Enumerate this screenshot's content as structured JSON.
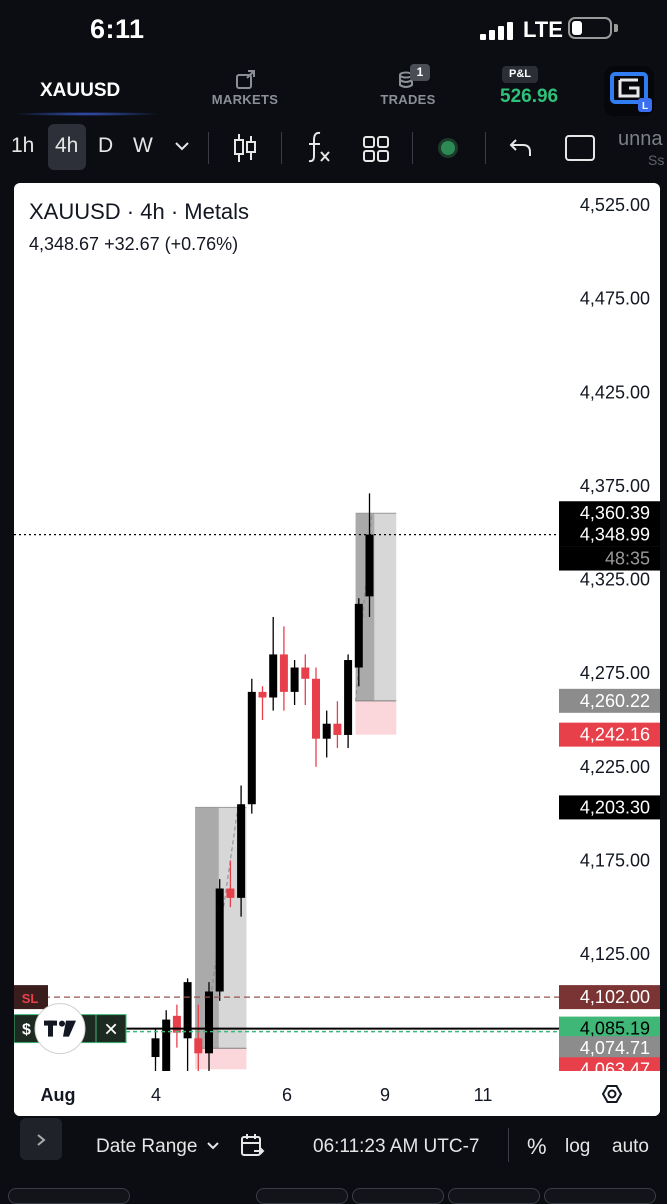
{
  "status": {
    "time": "6:11",
    "network": "LTE"
  },
  "nav": {
    "symbol_tab": "XAUUSD",
    "markets_label": "MARKETS",
    "trades_label": "TRADES",
    "trades_badge": "1",
    "pnl_label": "P&L",
    "pnl_value": "526.96",
    "pnl_color": "#2fc07a"
  },
  "toolbar": {
    "timeframes": [
      "1h",
      "4h",
      "D",
      "W"
    ],
    "active_timeframe": "4h",
    "layout_name": "unna",
    "layout_sub": "Ss"
  },
  "chart": {
    "title": "XAUUSD · 4h · Metals",
    "ohlc_line": "4,348.67  +32.67 (+0.76%)",
    "x_tick_labels": [
      "Aug",
      "4",
      "6",
      "9",
      "11"
    ],
    "trade_markers": {
      "sl_label": "SL",
      "close_symbol": "✕"
    }
  },
  "chart_data": {
    "type": "candlestick",
    "y_ticks": [
      4525,
      4475,
      4425,
      4375,
      4325,
      4275,
      4225,
      4175,
      4125
    ],
    "y_tick_labels": [
      "4,525.00",
      "4,475.00",
      "4,425.00",
      "4,375.00",
      "4,325.00",
      "4,275.00",
      "4,225.00",
      "4,175.00",
      "4,125.00"
    ],
    "x_labels": [
      "Aug",
      "4",
      "6",
      "9",
      "11"
    ],
    "price_tags": [
      {
        "label": "4,360.39",
        "price": 4360.39,
        "bg": "#000000",
        "fg": "#ffffff"
      },
      {
        "label": "4,348.99",
        "price": 4348.99,
        "bg": "#000000",
        "fg": "#ffffff"
      },
      {
        "label": "48:35",
        "price": 4336.2,
        "bg": "#000000",
        "fg": "#9a9a9a"
      },
      {
        "label": "4,260.22",
        "price": 4260.22,
        "bg": "#8c8c8c",
        "fg": "#ffffff"
      },
      {
        "label": "4,242.16",
        "price": 4242.16,
        "bg": "#e8404a",
        "fg": "#ffffff"
      },
      {
        "label": "4,203.30",
        "price": 4203.3,
        "bg": "#000000",
        "fg": "#ffffff"
      },
      {
        "label": "4,102.00",
        "price": 4102.0,
        "bg": "#7a3434",
        "fg": "#ffffff"
      },
      {
        "label": "4,085.19",
        "price": 4085.19,
        "bg": "#3fb777",
        "fg": "#000000"
      },
      {
        "label": "4,074.71",
        "price": 4074.71,
        "bg": "#8c8c8c",
        "fg": "#ffffff"
      },
      {
        "label": "4,063.47",
        "price": 4063.47,
        "bg": "#e8404a",
        "fg": "#ffffff"
      }
    ],
    "current_price": 4348.99,
    "stop_loss": 4102.0,
    "entry_price": 4085.19,
    "candles": [
      {
        "t": 0,
        "o": 4070,
        "h": 4085,
        "l": 4048,
        "c": 4080
      },
      {
        "t": 1,
        "o": 4060,
        "h": 4095,
        "l": 4052,
        "c": 4090
      },
      {
        "t": 2,
        "o": 4092,
        "h": 4098,
        "l": 4075,
        "c": 4083
      },
      {
        "t": 3,
        "o": 4080,
        "h": 4112,
        "l": 4052,
        "c": 4110
      },
      {
        "t": 4,
        "o": 4080,
        "h": 4098,
        "l": 4062,
        "c": 4072
      },
      {
        "t": 5,
        "o": 4072,
        "h": 4110,
        "l": 4055,
        "c": 4105
      },
      {
        "t": 6,
        "o": 4105,
        "h": 4165,
        "l": 4100,
        "c": 4160
      },
      {
        "t": 7,
        "o": 4160,
        "h": 4175,
        "l": 4150,
        "c": 4155
      },
      {
        "t": 8,
        "o": 4155,
        "h": 4215,
        "l": 4145,
        "c": 4205
      },
      {
        "t": 9,
        "o": 4205,
        "h": 4272,
        "l": 4200,
        "c": 4265
      },
      {
        "t": 10,
        "o": 4265,
        "h": 4268,
        "l": 4250,
        "c": 4262
      },
      {
        "t": 11,
        "o": 4262,
        "h": 4305,
        "l": 4255,
        "c": 4285
      },
      {
        "t": 12,
        "o": 4285,
        "h": 4300,
        "l": 4255,
        "c": 4265
      },
      {
        "t": 13,
        "o": 4265,
        "h": 4282,
        "l": 4258,
        "c": 4278
      },
      {
        "t": 14,
        "o": 4278,
        "h": 4285,
        "l": 4258,
        "c": 4272
      },
      {
        "t": 15,
        "o": 4272,
        "h": 4278,
        "l": 4225,
        "c": 4240
      },
      {
        "t": 16,
        "o": 4240,
        "h": 4255,
        "l": 4230,
        "c": 4248
      },
      {
        "t": 17,
        "o": 4248,
        "h": 4260,
        "l": 4235,
        "c": 4242
      },
      {
        "t": 18,
        "o": 4242,
        "h": 4285,
        "l": 4235,
        "c": 4282
      },
      {
        "t": 19,
        "o": 4278,
        "h": 4315,
        "l": 4268,
        "c": 4312
      },
      {
        "t": 20,
        "o": 4316,
        "h": 4371,
        "l": 4305,
        "c": 4349
      }
    ],
    "zones": [
      {
        "from_t": 3.7,
        "to_t": 8.5,
        "top": 4203.3,
        "bottom": 4074.71,
        "loss_bottom": 4063.47
      },
      {
        "from_t": 18.7,
        "to_t": 22.5,
        "top": 4360.39,
        "bottom": 4260.22,
        "loss_bottom": 4242.16
      }
    ]
  },
  "bottom_bar": {
    "date_range": "Date Range",
    "time": "06:11:23 AM UTC-7",
    "percent": "%",
    "log": "log",
    "auto": "auto"
  }
}
